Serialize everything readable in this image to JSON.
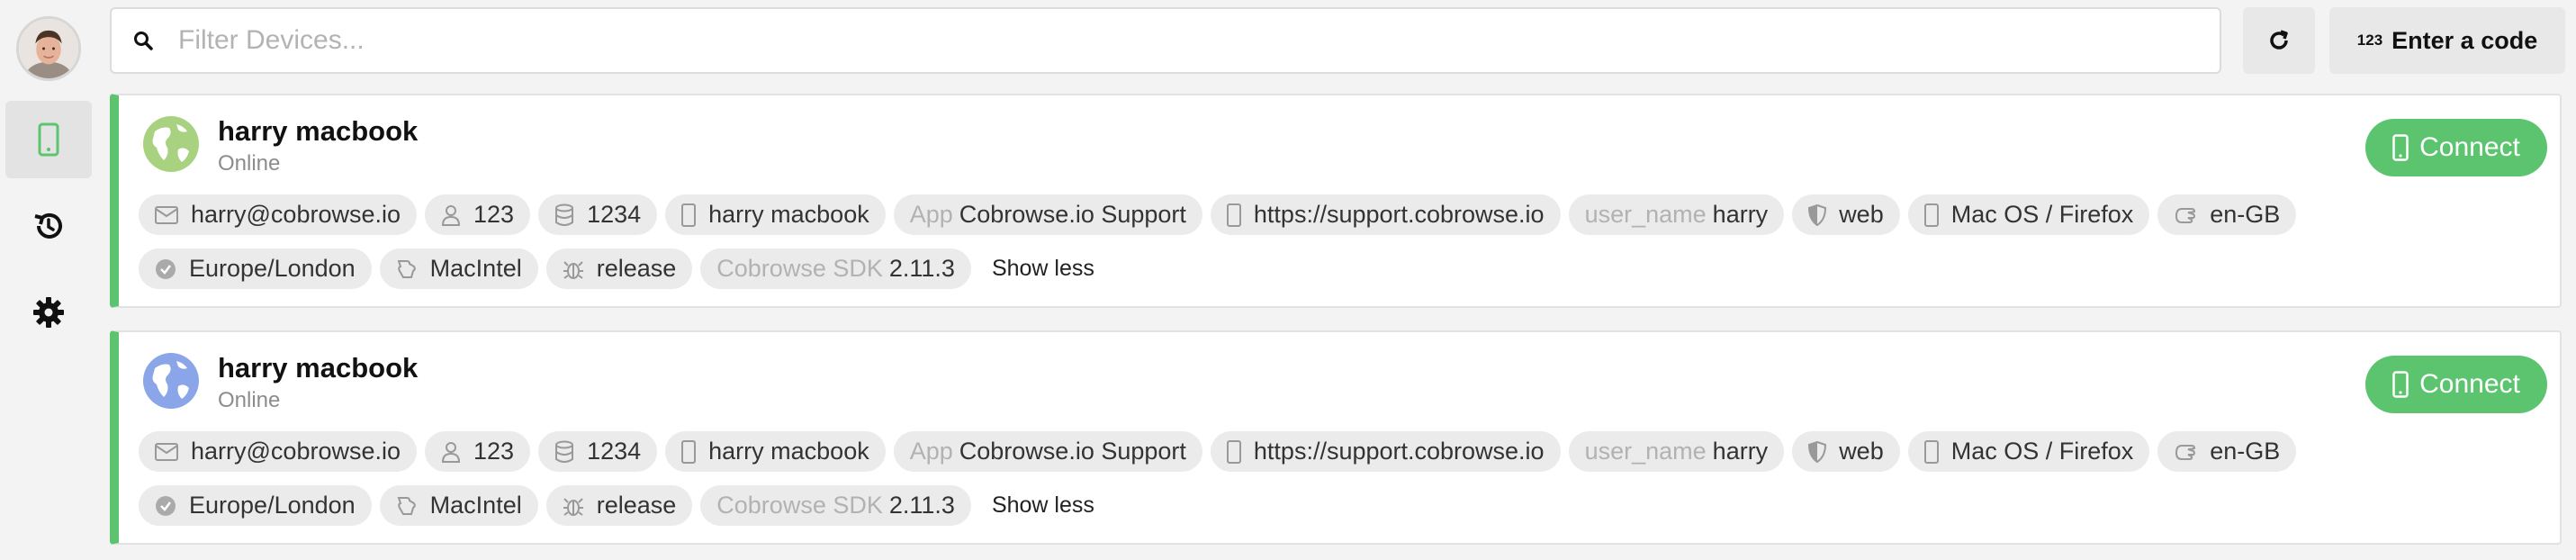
{
  "search": {
    "placeholder": "Filter Devices..."
  },
  "header": {
    "enter_code_icon": "123",
    "enter_code_label": "Enter a code"
  },
  "sidebar": {
    "items": [
      {
        "name": "devices",
        "icon": "mobile-phone-icon",
        "active": true
      },
      {
        "name": "history",
        "icon": "history-icon",
        "active": false
      },
      {
        "name": "settings",
        "icon": "gear-icon",
        "active": false
      }
    ]
  },
  "colors": {
    "accent": "#5cc46f",
    "tag_bg": "#ebebeb",
    "muted": "#b2b2b2"
  },
  "devices": [
    {
      "name": "harry macbook",
      "status": "Online",
      "connect_label": "Connect",
      "show_less": "Show less",
      "email": "harry@cobrowse.io",
      "user_id": "123",
      "device_id": "1234",
      "device_name": "harry macbook",
      "app_key": "App",
      "app_value": "Cobrowse.io Support",
      "url": "https://support.cobrowse.io",
      "user_name_key": "user_name",
      "user_name_value": "harry",
      "platform": "web",
      "os_browser": "Mac OS / Firefox",
      "locale": "en-GB",
      "timezone": "Europe/London",
      "cpu": "MacIntel",
      "build": "release",
      "sdk_key": "Cobrowse SDK",
      "sdk_value": "2.11.3"
    },
    {
      "name": "harry macbook",
      "status": "Online",
      "connect_label": "Connect",
      "show_less": "Show less",
      "email": "harry@cobrowse.io",
      "user_id": "123",
      "device_id": "1234",
      "device_name": "harry macbook",
      "app_key": "App",
      "app_value": "Cobrowse.io Support",
      "url": "https://support.cobrowse.io",
      "user_name_key": "user_name",
      "user_name_value": "harry",
      "platform": "web",
      "os_browser": "Mac OS / Firefox",
      "locale": "en-GB",
      "timezone": "Europe/London",
      "cpu": "MacIntel",
      "build": "release",
      "sdk_key": "Cobrowse SDK",
      "sdk_value": "2.11.3"
    }
  ]
}
